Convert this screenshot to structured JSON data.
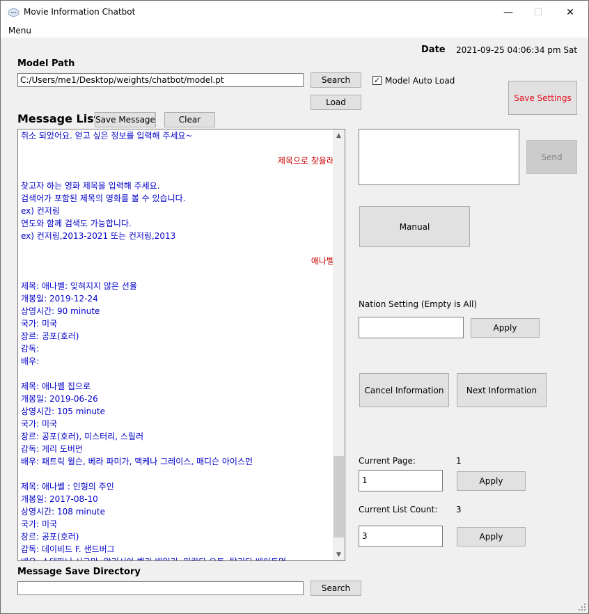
{
  "window": {
    "title": "Movie Information Chatbot",
    "minimize_glyph": "—",
    "maximize_glyph": "☐",
    "close_glyph": "✕"
  },
  "menubar": {
    "menu_label": "Menu"
  },
  "date": {
    "label": "Date",
    "value": "2021-09-25 04:06:34 pm Sat"
  },
  "model": {
    "label": "Model Path",
    "path_value": "C:/Users/me1/Desktop/weights/chatbot/model.pt",
    "search_label": "Search",
    "load_label": "Load",
    "auto_load_label": "Model Auto Load",
    "auto_load_checked": true
  },
  "save_settings_label": "Save Settings",
  "colors": {
    "save_settings_text": "#e81123",
    "bot_text": "#0000c8",
    "user_text": "#c80000"
  },
  "message_list": {
    "label": "Message List",
    "save_message_label": "Save Message",
    "clear_label": "Clear",
    "lines": [
      {
        "role": "bot",
        "text": "취소 되었어요. 얻고 싶은 정보를 입력해 주세요~"
      },
      {
        "role": "blank",
        "text": ""
      },
      {
        "role": "user",
        "text": "제목으로 찾을래"
      },
      {
        "role": "blank",
        "text": ""
      },
      {
        "role": "bot",
        "text": "찾고자 하는 영화 제목을 입력해 주세요."
      },
      {
        "role": "bot",
        "text": "검색어가 포함된 제목의 영화를 볼 수 있습니다."
      },
      {
        "role": "bot",
        "text": "ex) 컨저링"
      },
      {
        "role": "bot",
        "text": "연도와 함께 검색도 가능합니다."
      },
      {
        "role": "bot",
        "text": "ex) 컨저링,2013-2021 또는 컨저링,2013"
      },
      {
        "role": "blank",
        "text": ""
      },
      {
        "role": "user",
        "text": "애나벨"
      },
      {
        "role": "blank",
        "text": ""
      },
      {
        "role": "bot",
        "text": "제목: 애나벨: 잊혀지지 않은 선율"
      },
      {
        "role": "bot",
        "text": "개봉일: 2019-12-24"
      },
      {
        "role": "bot",
        "text": "상영시간: 90 minute"
      },
      {
        "role": "bot",
        "text": "국가: 미국"
      },
      {
        "role": "bot",
        "text": "장르: 공포(호러)"
      },
      {
        "role": "bot",
        "text": "감독:"
      },
      {
        "role": "bot",
        "text": "배우:"
      },
      {
        "role": "blank",
        "text": ""
      },
      {
        "role": "bot",
        "text": "제목: 애나벨 집으로"
      },
      {
        "role": "bot",
        "text": "개봉일: 2019-06-26"
      },
      {
        "role": "bot",
        "text": "상영시간: 105 minute"
      },
      {
        "role": "bot",
        "text": "국가: 미국"
      },
      {
        "role": "bot",
        "text": "장르: 공포(호러), 미스터리, 스릴러"
      },
      {
        "role": "bot",
        "text": "감독: 게리 도버먼"
      },
      {
        "role": "bot",
        "text": "배우: 패트릭 윌슨, 베라 파미가, 맥케나 그레이스, 매디슨 아이스먼"
      },
      {
        "role": "blank",
        "text": ""
      },
      {
        "role": "bot",
        "text": "제목: 애나벨 : 인형의 주인"
      },
      {
        "role": "bot",
        "text": "개봉일: 2017-08-10"
      },
      {
        "role": "bot",
        "text": "상영시간: 108 minute"
      },
      {
        "role": "bot",
        "text": "국가: 미국"
      },
      {
        "role": "bot",
        "text": "장르: 공포(호러)"
      },
      {
        "role": "bot",
        "text": "감독: 데이비드 F. 샌드버그"
      },
      {
        "role": "bot",
        "text": "배우: 스테파니 시그만, 알리시아 벨라 베일리, 미란다 오토, 탈리타 베이트먼"
      }
    ]
  },
  "input_area": {
    "value": "",
    "send_label": "Send"
  },
  "manual_label": "Manual",
  "nation": {
    "label": "Nation Setting (Empty is All)",
    "value": "",
    "apply_label": "Apply"
  },
  "cancel_info_label": "Cancel Information",
  "next_info_label": "Next Information",
  "current_page": {
    "label": "Current Page:",
    "display": "1",
    "value": "1",
    "apply_label": "Apply"
  },
  "current_list_count": {
    "label": "Current List Count:",
    "display": "3",
    "value": "3",
    "apply_label": "Apply"
  },
  "save_dir": {
    "label": "Message Save Directory",
    "value": "",
    "search_label": "Search"
  }
}
